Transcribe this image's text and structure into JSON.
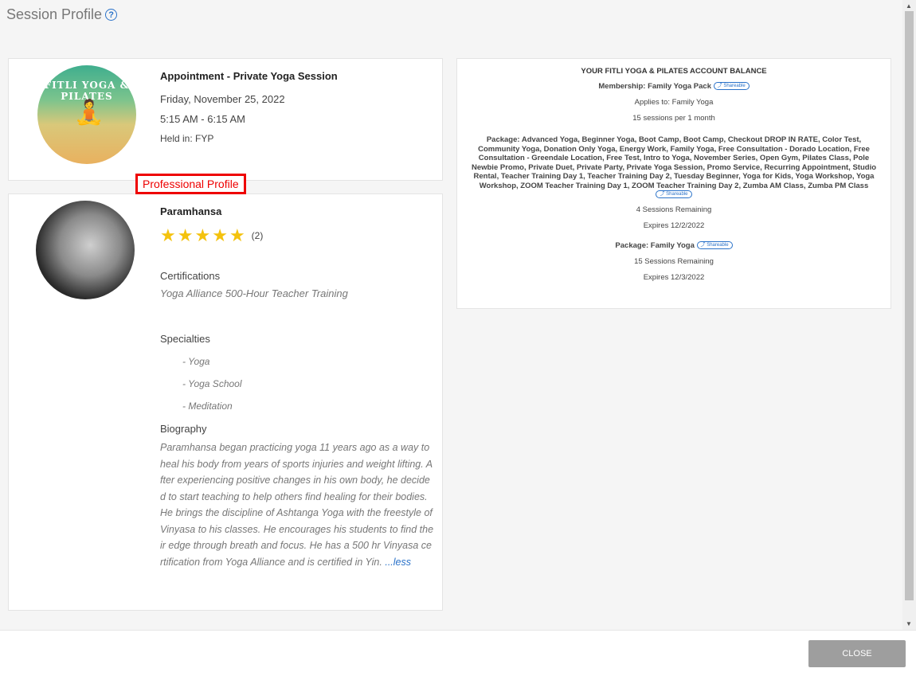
{
  "page": {
    "title": "Session Profile"
  },
  "appointment": {
    "title": "Appointment - Private Yoga Session",
    "date": "Friday, November 25, 2022",
    "time": "5:15 AM - 6:15 AM",
    "location": "Held in: FYP",
    "logo_text": "FITLI YOGA & PILATES"
  },
  "professional": {
    "label": "Professional Profile",
    "name": "Paramhansa",
    "rating_stars": 5,
    "rating_count": "(2)",
    "certifications_heading": "Certifications",
    "certification": "Yoga Alliance 500-Hour Teacher Training",
    "specialties_heading": "Specialties",
    "specialties": [
      "- Yoga",
      "- Yoga School",
      "- Meditation"
    ],
    "biography_heading": "Biography",
    "biography": "Paramhansa began practicing yoga 11 years ago as a way to heal his body from years of sports injuries and weight lifting. After experiencing positive changes in his own body, he decided to start teaching to help others find healing for their bodies. He brings the discipline of Ashtanga Yoga with the freestyle of Vinyasa to his classes. He encourages his students to find their edge through breath and focus. He has a 500 hr Vinyasa certification from Yoga Alliance and is certified in Yin.",
    "less_link": "...less"
  },
  "balance": {
    "title": "YOUR FITLI YOGA & PILATES ACCOUNT BALANCE",
    "membership": {
      "label": "Membership: Family Yoga Pack",
      "badge": "Shareable",
      "applies_to": "Applies to: Family Yoga",
      "sessions": "15 sessions per 1 month"
    },
    "package1": {
      "label": "Package: Advanced Yoga, Beginner Yoga, Boot Camp, Boot Camp, Checkout DROP IN RATE, Color Test, Community Yoga, Donation Only Yoga, Energy Work, Family Yoga, Free Consultation - Dorado Location, Free Consultation - Greendale Location, Free Test, Intro to Yoga, November Series, Open Gym, Pilates Class, Pole Newbie Promo, Private Duet, Private Party, Private Yoga Session, Promo Service, Recurring Appointment, Studio Rental, Teacher Training Day 1, Teacher Training Day 2, Tuesday Beginner, Yoga for Kids, Yoga Workshop, Yoga Workshop, ZOOM Teacher Training Day 1, ZOOM Teacher Training Day 2, Zumba AM Class, Zumba PM Class",
      "badge": "Shareable",
      "remaining": "4 Sessions Remaining",
      "expires": "Expires 12/2/2022"
    },
    "package2": {
      "label": "Package: Family Yoga",
      "badge": "Shareable",
      "remaining": "15 Sessions Remaining",
      "expires": "Expires 12/3/2022"
    }
  },
  "footer": {
    "close_label": "CLOSE"
  }
}
